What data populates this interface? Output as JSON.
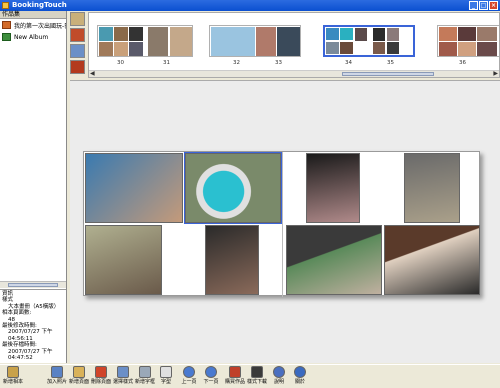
{
  "window": {
    "title": "BookingTouch",
    "minimize": "_",
    "maximize": "□",
    "close": "×"
  },
  "left_panel": {
    "header": "作品集",
    "albums": [
      {
        "label": "我的第一次出國玩-巴厘島"
      },
      {
        "label": "New Album"
      }
    ]
  },
  "info": {
    "header": "資訊",
    "rows": [
      {
        "label": "樣式",
        "value": "大本畫冊（A5橫版）"
      },
      {
        "label": "相本頁面數:",
        "value": "48"
      },
      {
        "label": "最後修改時間:",
        "value": "2007/07/27 下午 04:56:11"
      },
      {
        "label": "最後存檔時間:",
        "value": "2007/07/27 下午 04:47:52"
      }
    ]
  },
  "thumb_strip": {
    "pages": [
      {
        "left": "30",
        "right": "31"
      },
      {
        "left": "32",
        "right": "33"
      },
      {
        "left": "34",
        "right": "35"
      },
      {
        "left": "36",
        "right": ""
      }
    ],
    "scroll_left": "◀",
    "scroll_right": "▶"
  },
  "toolbar": {
    "buttons": [
      {
        "label": "新增相本",
        "icon": "new-album-icon",
        "color": "#c9a24a"
      },
      {
        "label": "加入照片",
        "icon": "add-photo-icon",
        "color": "#5a82c4"
      },
      {
        "label": "新增頁面",
        "icon": "add-page-icon",
        "color": "#d9b25a"
      },
      {
        "label": "刪除頁面",
        "icon": "delete-page-icon",
        "color": "#d0452a"
      },
      {
        "label": "選擇樣式",
        "icon": "choose-style-icon",
        "color": "#6b8fc7"
      },
      {
        "label": "新增字框",
        "icon": "add-textbox-icon",
        "color": "#9aa8b8"
      },
      {
        "label": "字型",
        "icon": "font-icon",
        "color": "#e0e0e0"
      },
      {
        "label": "上一頁",
        "icon": "prev-page-icon",
        "color": "#4a7ad0"
      },
      {
        "label": "下一頁",
        "icon": "next-page-icon",
        "color": "#4a7ad0"
      },
      {
        "label": "購買作品",
        "icon": "buy-work-icon",
        "color": "#c0402a"
      },
      {
        "label": "樣式下載",
        "icon": "style-download-icon",
        "color": "#3a3a3a"
      },
      {
        "label": "說明",
        "icon": "help-icon",
        "color": "#4a6fc0"
      },
      {
        "label": "關於",
        "icon": "about-icon",
        "color": "#3a6ac0"
      }
    ]
  }
}
